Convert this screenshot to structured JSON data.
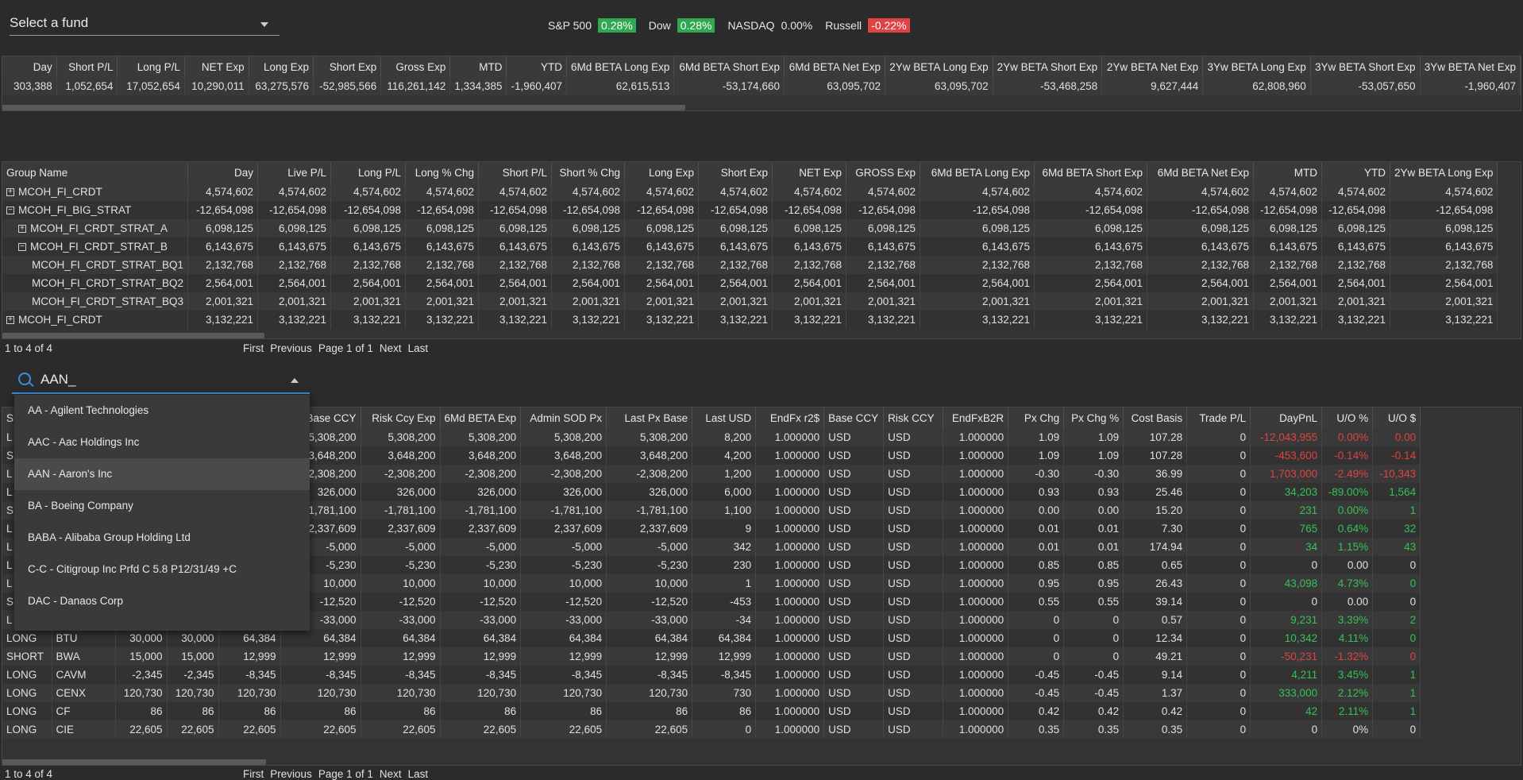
{
  "fund_select": {
    "placeholder": "Select a fund"
  },
  "indices": [
    {
      "name": "S&P 500",
      "value": "0.28%",
      "status": "pos"
    },
    {
      "name": "Dow",
      "value": "0.28%",
      "status": "pos"
    },
    {
      "name": "NASDAQ",
      "value": "0.00%",
      "status": "flat"
    },
    {
      "name": "Russell",
      "value": "-0.22%",
      "status": "neg"
    }
  ],
  "colors": {
    "positive": "#2fa84f",
    "negative": "#e04343",
    "accent": "#3b8de0"
  },
  "summary_table": {
    "columns": [
      "Day",
      "Short P/L",
      "Long P/L",
      "NET Exp",
      "Long Exp",
      "Short Exp",
      "Gross Exp",
      "MTD",
      "YTD",
      "6Md BETA Long Exp",
      "6Md BETA Short Exp",
      "6Md BETA Net Exp",
      "2Yw BETA Long Exp",
      "2Yw BETA Short Exp",
      "2Yw BETA Net Exp",
      "3Yw BETA Long Exp",
      "3Yw BETA Short Exp",
      "3Yw BETA Net Exp"
    ],
    "rows": [
      [
        "303,388",
        "1,052,654",
        "17,052,654",
        "10,290,011",
        "63,275,576",
        "-52,985,566",
        "116,261,142",
        "1,334,385",
        "-1,960,407",
        "62,615,513",
        "-53,174,660",
        "63,095,702",
        "63,095,702",
        "-53,468,258",
        "9,627,444",
        "62,808,960",
        "-53,057,650",
        "-1,960,407"
      ]
    ]
  },
  "group_table": {
    "columns": [
      "Group Name",
      "Day",
      "Live P/L",
      "Long P/L",
      "Long % Chg",
      "Short P/L",
      "Short % Chg",
      "Long Exp",
      "Short Exp",
      "NET Exp",
      "GROSS Exp",
      "6Md BETA Long Exp",
      "6Md BETA Short Exp",
      "6Md BETA Net Exp",
      "MTD",
      "YTD",
      "2Yw BETA Long Exp"
    ],
    "rows": [
      {
        "name": "MCOH_FI_CRDT",
        "expander": "+",
        "indent": 0,
        "value": "4,574,602"
      },
      {
        "name": "MCOH_FI_BIG_STRAT",
        "expander": "−",
        "indent": 0,
        "value": "-12,654,098"
      },
      {
        "name": "MCOH_FI_CRDT_STRAT_A",
        "expander": "+",
        "indent": 1,
        "value": "6,098,125"
      },
      {
        "name": "MCOH_FI_CRDT_STRAT_B",
        "expander": "−",
        "indent": 1,
        "value": "6,143,675"
      },
      {
        "name": "MCOH_FI_CRDT_STRAT_BQ1",
        "expander": "",
        "indent": 2,
        "value": "2,132,768"
      },
      {
        "name": "MCOH_FI_CRDT_STRAT_BQ2",
        "expander": "",
        "indent": 2,
        "value": "2,564,001"
      },
      {
        "name": "MCOH_FI_CRDT_STRAT_BQ3",
        "expander": "",
        "indent": 2,
        "value": "2,001,321"
      },
      {
        "name": "MCOH_FI_CRDT",
        "expander": "+",
        "indent": 0,
        "value": "3,132,221"
      }
    ]
  },
  "pager1": {
    "count": "1 to 4 of 4",
    "first": "First",
    "previous": "Previous",
    "page": "Page 1 of 1",
    "next": "Next",
    "last": "Last"
  },
  "search": {
    "value": "AAN_"
  },
  "dropdown": {
    "items": [
      "AA - Agilent Technologies",
      "AAC - Aac Holdings Inc",
      "AAN - Aaron's Inc",
      "BA - Boeing Company",
      "BABA - Alibaba Group Holding Ltd",
      "C-C - Citigroup Inc Prfd C 5.8 P12/31/49 +C",
      "DAC - Danaos Corp"
    ],
    "active_index": 2
  },
  "positions_table": {
    "columns": [
      "S",
      "",
      "",
      "",
      "Exp USD",
      "Exp Base CCY",
      "Risk Ccy Exp",
      "6Md BETA Exp",
      "Admin SOD Px",
      "Last Px Base",
      "Last USD",
      "EndFx r2$",
      "Base CCY",
      "Risk CCY",
      "EndFxB2R",
      "Px Chg",
      "Px Chg %",
      "Cost Basis",
      "Trade P/L",
      "DayPnL",
      "U/O %",
      "U/O $"
    ],
    "rows": [
      {
        "side": "L",
        "ticker": "",
        "q1": "",
        "q2": "",
        "exp": "5,308,200",
        "last": "8,200",
        "pxchg": "1.09",
        "pxpct": "1.09",
        "cost": "107.28",
        "trade": "0",
        "daypnl": "-12,043,955",
        "uopct": "0.00%",
        "uod": "0.00",
        "tone": "red"
      },
      {
        "side": "S",
        "ticker": "",
        "q1": "",
        "q2": "",
        "exp": "3,648,200",
        "last": "4,200",
        "pxchg": "1.09",
        "pxpct": "1.09",
        "cost": "107.28",
        "trade": "0",
        "daypnl": "-453,600",
        "uopct": "-0.14%",
        "uod": "-0.14",
        "tone": "red"
      },
      {
        "side": "L",
        "ticker": "",
        "q1": "",
        "q2": "",
        "exp": "-2,308,200",
        "last": "1,200",
        "pxchg": "-0.30",
        "pxpct": "-0.30",
        "cost": "36.99",
        "trade": "0",
        "daypnl": "1,703,000",
        "uopct": "-2.49%",
        "uod": "-10,343",
        "tone": "red"
      },
      {
        "side": "L",
        "ticker": "",
        "q1": "",
        "q2": "",
        "exp": "326,000",
        "last": "6,000",
        "pxchg": "0.93",
        "pxpct": "0.93",
        "cost": "25.46",
        "trade": "0",
        "daypnl": "34,203",
        "uopct": "-89.00%",
        "uod": "1,564",
        "tone": "green"
      },
      {
        "side": "S",
        "ticker": "",
        "q1": "",
        "q2": "",
        "exp": "-1,781,100",
        "last": "1,100",
        "pxchg": "0.00",
        "pxpct": "0.00",
        "cost": "15.20",
        "trade": "0",
        "daypnl": "231",
        "uopct": "0.00%",
        "uod": "1",
        "tone": "green"
      },
      {
        "side": "L",
        "ticker": "",
        "q1": "",
        "q2": "",
        "exp": "2,337,609",
        "last": "9",
        "pxchg": "0.01",
        "pxpct": "0.01",
        "cost": "7.30",
        "trade": "0",
        "daypnl": "765",
        "uopct": "0.64%",
        "uod": "32",
        "tone": "green"
      },
      {
        "side": "L",
        "ticker": "",
        "q1": "",
        "q2": "",
        "exp": "-5,000",
        "last": "342",
        "pxchg": "0.01",
        "pxpct": "0.01",
        "cost": "174.94",
        "trade": "0",
        "daypnl": "34",
        "uopct": "1.15%",
        "uod": "43",
        "tone": "green"
      },
      {
        "side": "L",
        "ticker": "",
        "q1": "",
        "q2": "",
        "exp": "-5,230",
        "last": "230",
        "pxchg": "0.85",
        "pxpct": "0.85",
        "cost": "0.65",
        "trade": "0",
        "daypnl": "0",
        "uopct": "0.00",
        "uod": "0",
        "tone": "plain"
      },
      {
        "side": "L",
        "ticker": "",
        "q1": "",
        "q2": "",
        "exp": "10,000",
        "last": "1",
        "pxchg": "0.95",
        "pxpct": "0.95",
        "cost": "26.43",
        "trade": "0",
        "daypnl": "43,098",
        "uopct": "4.73%",
        "uod": "0",
        "tone": "green"
      },
      {
        "side": "S",
        "ticker": "",
        "q1": "",
        "q2": "",
        "exp": "-12,520",
        "last": "-453",
        "pxchg": "0.55",
        "pxpct": "0.55",
        "cost": "39.14",
        "trade": "0",
        "daypnl": "0",
        "uopct": "0.00",
        "uod": "0",
        "tone": "plain"
      },
      {
        "side": "L",
        "ticker": "",
        "q1": "",
        "q2": "",
        "exp": "-33,000",
        "last": "-34",
        "pxchg": "0",
        "pxpct": "0",
        "cost": "0.57",
        "trade": "0",
        "daypnl": "9,231",
        "uopct": "3.39%",
        "uod": "2",
        "tone": "green"
      },
      {
        "side": "LONG",
        "ticker": "BTU",
        "q1": "30,000",
        "q2": "30,000",
        "exp": "64,384",
        "last": "64,384",
        "pxchg": "0",
        "pxpct": "0",
        "cost": "12.34",
        "trade": "0",
        "daypnl": "10,342",
        "uopct": "4.11%",
        "uod": "0",
        "tone": "green"
      },
      {
        "side": "SHORT",
        "ticker": "BWA",
        "q1": "15,000",
        "q2": "15,000",
        "exp": "12,999",
        "last": "12,999",
        "pxchg": "0",
        "pxpct": "0",
        "cost": "49.21",
        "trade": "0",
        "daypnl": "-50,231",
        "uopct": "-1.32%",
        "uod": "0",
        "tone": "red"
      },
      {
        "side": "LONG",
        "ticker": "CAVM",
        "q1": "-2,345",
        "q2": "-2,345",
        "exp": "-8,345",
        "last": "-8,345",
        "pxchg": "-0.45",
        "pxpct": "-0.45",
        "cost": "9.14",
        "trade": "0",
        "daypnl": "4,211",
        "uopct": "3.45%",
        "uod": "1",
        "tone": "green"
      },
      {
        "side": "LONG",
        "ticker": "CENX",
        "q1": "120,730",
        "q2": "120,730",
        "exp": "120,730",
        "last": "730",
        "pxchg": "-0.45",
        "pxpct": "-0.45",
        "cost": "1.37",
        "trade": "0",
        "daypnl": "333,000",
        "uopct": "2.12%",
        "uod": "1",
        "tone": "green"
      },
      {
        "side": "LONG",
        "ticker": "CF",
        "q1": "86",
        "q2": "86",
        "exp": "86",
        "last": "86",
        "pxchg": "0.42",
        "pxpct": "0.42",
        "cost": "0.42",
        "trade": "0",
        "daypnl": "42",
        "uopct": "2.11%",
        "uod": "1",
        "tone": "green"
      },
      {
        "side": "LONG",
        "ticker": "CIE",
        "q1": "22,605",
        "q2": "22,605",
        "exp": "22,605",
        "last": "0",
        "pxchg": "0.35",
        "pxpct": "0.35",
        "cost": "0.35",
        "trade": "0",
        "daypnl": "0",
        "uopct": "0%",
        "uod": "0",
        "tone": "plain"
      }
    ],
    "fx": "1.000000",
    "ccy": "USD"
  },
  "pager2": {
    "count": "1 to 4 of 4",
    "first": "First",
    "previous": "Previous",
    "page": "Page 1 of 1",
    "next": "Next",
    "last": "Last"
  }
}
